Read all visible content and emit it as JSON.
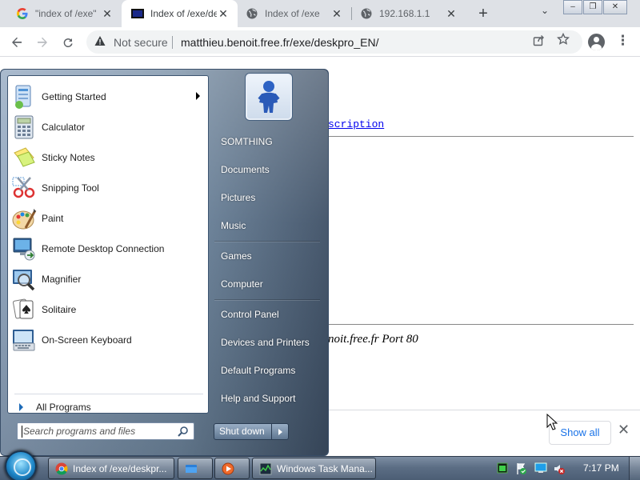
{
  "browser": {
    "tabs": [
      {
        "title": "\"index of /exe\"",
        "icon": "google-g-icon",
        "active": false
      },
      {
        "title": "Index of /exe/deskpro_EN",
        "icon": "black-square-favicon",
        "active": true
      },
      {
        "title": "Index of /exe",
        "icon": "globe-icon",
        "active": false
      },
      {
        "title": "192.168.1.1",
        "icon": "globe-icon",
        "active": false
      }
    ],
    "close_glyph": "✕",
    "new_tab_glyph": "+",
    "tab_search_glyph": "⌄",
    "window_controls": {
      "minimize": "‒",
      "restore": "❐",
      "close": "✕"
    },
    "security_label": "Not secure",
    "url": "matthieu.benoit.free.fr/exe/deskpro_EN/",
    "icons": {
      "back": "arrow-left-icon",
      "forward": "arrow-right-icon",
      "reload": "reload-icon",
      "share": "share-icon",
      "bookmark": "star-icon",
      "profile": "person-icon",
      "menu": "three-dots-icon"
    }
  },
  "page": {
    "partial_link": "scription",
    "partial_address": "noit.free.fr Port 80"
  },
  "download_bar": {
    "show_all_label": "Show all",
    "close_glyph": "✕"
  },
  "start_menu": {
    "programs": [
      {
        "label": "Getting Started",
        "icon": "getting-started-icon",
        "has_submenu": true
      },
      {
        "label": "Calculator",
        "icon": "calculator-icon",
        "has_submenu": false
      },
      {
        "label": "Sticky Notes",
        "icon": "sticky-notes-icon",
        "has_submenu": false
      },
      {
        "label": "Snipping Tool",
        "icon": "scissors-icon",
        "has_submenu": false
      },
      {
        "label": "Paint",
        "icon": "paint-palette-icon",
        "has_submenu": false
      },
      {
        "label": "Remote Desktop Connection",
        "icon": "remote-desktop-icon",
        "has_submenu": false
      },
      {
        "label": "Magnifier",
        "icon": "magnifier-icon",
        "has_submenu": false
      },
      {
        "label": "Solitaire",
        "icon": "playing-cards-icon",
        "has_submenu": false
      },
      {
        "label": "On-Screen Keyboard",
        "icon": "keyboard-icon",
        "has_submenu": false
      }
    ],
    "all_programs_label": "All Programs",
    "search_placeholder": "Search programs and files",
    "right_items": [
      {
        "label": "SOMTHING"
      },
      {
        "label": "Documents"
      },
      {
        "label": "Pictures"
      },
      {
        "label": "Music"
      },
      {
        "label": "Games"
      },
      {
        "label": "Computer"
      },
      {
        "label": "Control Panel"
      },
      {
        "label": "Devices and Printers"
      },
      {
        "label": "Default Programs"
      },
      {
        "label": "Help and Support"
      }
    ],
    "shutdown_label": "Shut down"
  },
  "taskbar": {
    "buttons": [
      {
        "label": "Index of /exe/deskpr...",
        "icon": "chrome-icon"
      },
      {
        "label": "",
        "icon": "explorer-folder-icon"
      },
      {
        "label": "",
        "icon": "media-player-icon"
      },
      {
        "label": "Windows Task Mana...",
        "icon": "task-manager-icon"
      }
    ],
    "clock": "7:17 PM"
  },
  "colors": {
    "link": "#0000ee",
    "chrome_accent": "#1a73e8",
    "start_menu_blue": "#6f879f",
    "taskbar": "#5c6e85"
  }
}
